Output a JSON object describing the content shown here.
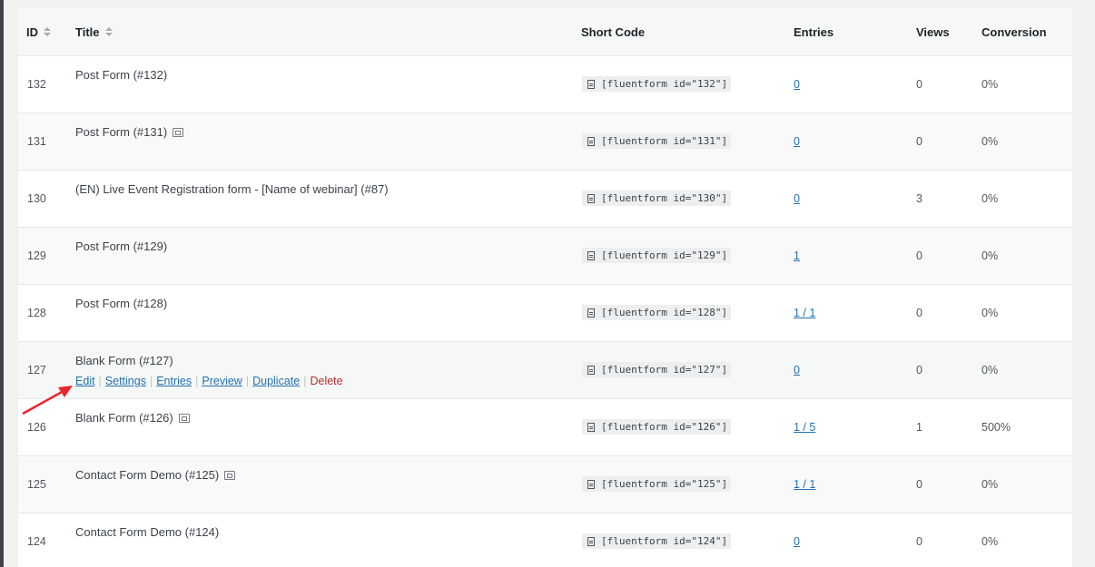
{
  "columns": {
    "id": "ID",
    "title": "Title",
    "short_code": "Short Code",
    "entries": "Entries",
    "views": "Views",
    "conversion": "Conversion"
  },
  "rows": [
    {
      "id": "132",
      "title": "Post Form (#132)",
      "preview": false,
      "short_code": "[fluentform id=\"132\"]",
      "entries": "0",
      "views": "0",
      "conversion": "0%"
    },
    {
      "id": "131",
      "title": "Post Form (#131)",
      "preview": true,
      "short_code": "[fluentform id=\"131\"]",
      "entries": "0",
      "views": "0",
      "conversion": "0%"
    },
    {
      "id": "130",
      "title": "(EN) Live Event Registration form - [Name of webinar] (#87)",
      "preview": false,
      "short_code": "[fluentform id=\"130\"]",
      "entries": "0",
      "views": "3",
      "conversion": "0%"
    },
    {
      "id": "129",
      "title": "Post Form (#129)",
      "preview": false,
      "short_code": "[fluentform id=\"129\"]",
      "entries": "1",
      "views": "0",
      "conversion": "0%"
    },
    {
      "id": "128",
      "title": "Post Form (#128)",
      "preview": false,
      "short_code": "[fluentform id=\"128\"]",
      "entries": "1 / 1",
      "views": "0",
      "conversion": "0%"
    },
    {
      "id": "127",
      "title": "Blank Form (#127)",
      "preview": false,
      "short_code": "[fluentform id=\"127\"]",
      "entries": "0",
      "views": "0",
      "conversion": "0%"
    },
    {
      "id": "126",
      "title": "Blank Form (#126)",
      "preview": true,
      "short_code": "[fluentform id=\"126\"]",
      "entries": "1 / 5",
      "views": "1",
      "conversion": "500%"
    },
    {
      "id": "125",
      "title": "Contact Form Demo (#125)",
      "preview": true,
      "short_code": "[fluentform id=\"125\"]",
      "entries": "1 / 1",
      "views": "0",
      "conversion": "0%"
    },
    {
      "id": "124",
      "title": "Contact Form Demo (#124)",
      "preview": false,
      "short_code": "[fluentform id=\"124\"]",
      "entries": "0",
      "views": "0",
      "conversion": "0%"
    }
  ],
  "row_actions": {
    "edit": "Edit",
    "settings": "Settings",
    "entries": "Entries",
    "preview": "Preview",
    "duplicate": "Duplicate",
    "delete": "Delete"
  },
  "colors": {
    "link": "#2271b1",
    "delete": "#b32d2e",
    "annotation_arrow": "#e8262d"
  }
}
